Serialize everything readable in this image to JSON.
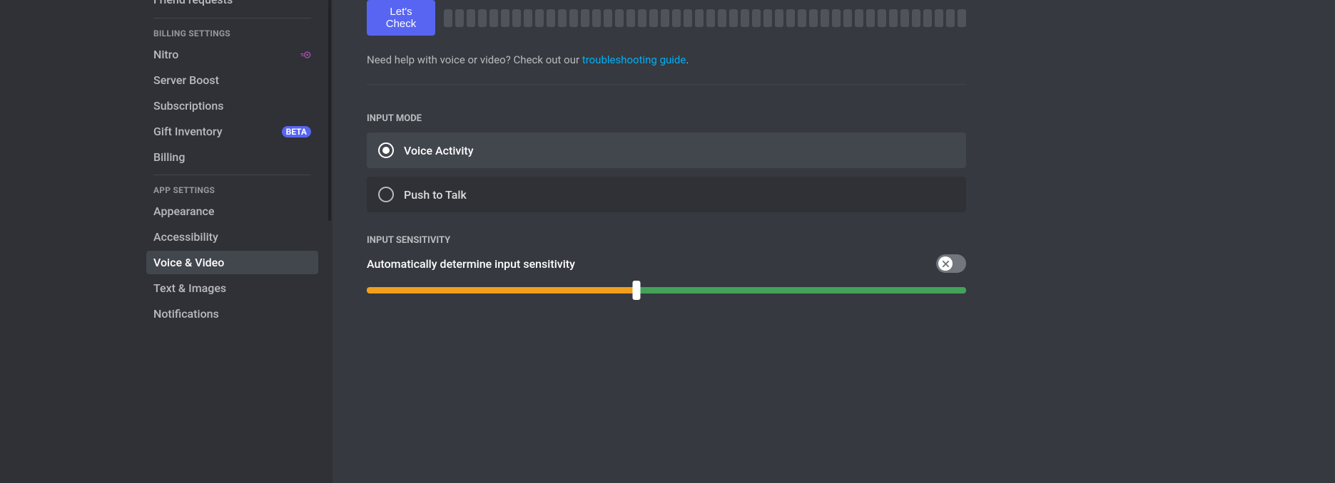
{
  "sidebar": {
    "friend_requests": "Friend requests",
    "billing_header": "BILLING SETTINGS",
    "app_header": "APP SETTINGS",
    "items": {
      "nitro": "Nitro",
      "server_boost": "Server Boost",
      "subscriptions": "Subscriptions",
      "gift_inventory": "Gift Inventory",
      "billing": "Billing",
      "appearance": "Appearance",
      "accessibility": "Accessibility",
      "voice_video": "Voice & Video",
      "text_images": "Text & Images",
      "notifications": "Notifications"
    },
    "beta_badge": "BETA"
  },
  "main": {
    "lets_check": "Let's Check",
    "help_prefix": "Need help with voice or video? Check out our ",
    "help_link": "troubleshooting guide",
    "help_suffix": ".",
    "input_mode_header": "INPUT MODE",
    "voice_activity": "Voice Activity",
    "push_to_talk": "Push to Talk",
    "sensitivity_header": "INPUT SENSITIVITY",
    "auto_sensitivity": "Automatically determine input sensitivity",
    "slider_percent": 45
  }
}
